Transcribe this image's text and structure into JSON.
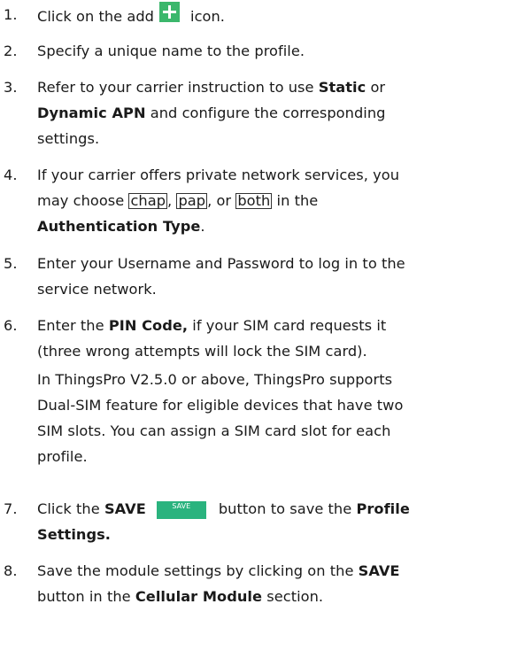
{
  "steps": [
    {
      "num": "1.",
      "pre": "Click on the add",
      "icon": "plus-add-icon",
      "post": "icon."
    },
    {
      "num": "2.",
      "text": "Specify a unique name to the profile."
    },
    {
      "num": "3.",
      "l1_pre": "Refer to your carrier instruction to use",
      "static": "Static",
      "or": "or",
      "dynamic": "Dynamic APN",
      "l2_post": "and configure the corresponding",
      "l3": "settings."
    },
    {
      "num": "4.",
      "l1": "If your carrier offers private network services, you",
      "l2_pre": "may choose",
      "chap": "chap",
      "sep1": ",",
      "pap": "pap",
      "sep2": ", or",
      "both": "both",
      "l2_post": "in the",
      "auth": "Authentication Type",
      "period": "."
    },
    {
      "num": "5.",
      "l1": "Enter your Username and Password to log in to the",
      "l2": "service network."
    },
    {
      "num": "6.",
      "l1_pre": "Enter the",
      "pin": "PIN Code,",
      "l1_post": "if your SIM card requests it",
      "l2": "(three wrong attempts will lock the SIM card).",
      "note_l1": "In ThingsPro V2.5.0 or above, ThingsPro supports",
      "note_l2": "Dual-SIM feature for eligible devices that have two",
      "note_l3": "SIM slots. You can assign a SIM card slot for each",
      "note_l4": "profile."
    },
    {
      "num": "7.",
      "pre": "Click the",
      "save": "SAVE",
      "btn_label": "SAVE",
      "mid": "button to save the",
      "profile": "Profile",
      "settings": "Settings."
    },
    {
      "num": "8.",
      "l1_pre": "Save the module settings by clicking on the",
      "save": "SAVE",
      "l2_pre": "button in the",
      "module": "Cellular Module",
      "l2_post": "section."
    }
  ]
}
